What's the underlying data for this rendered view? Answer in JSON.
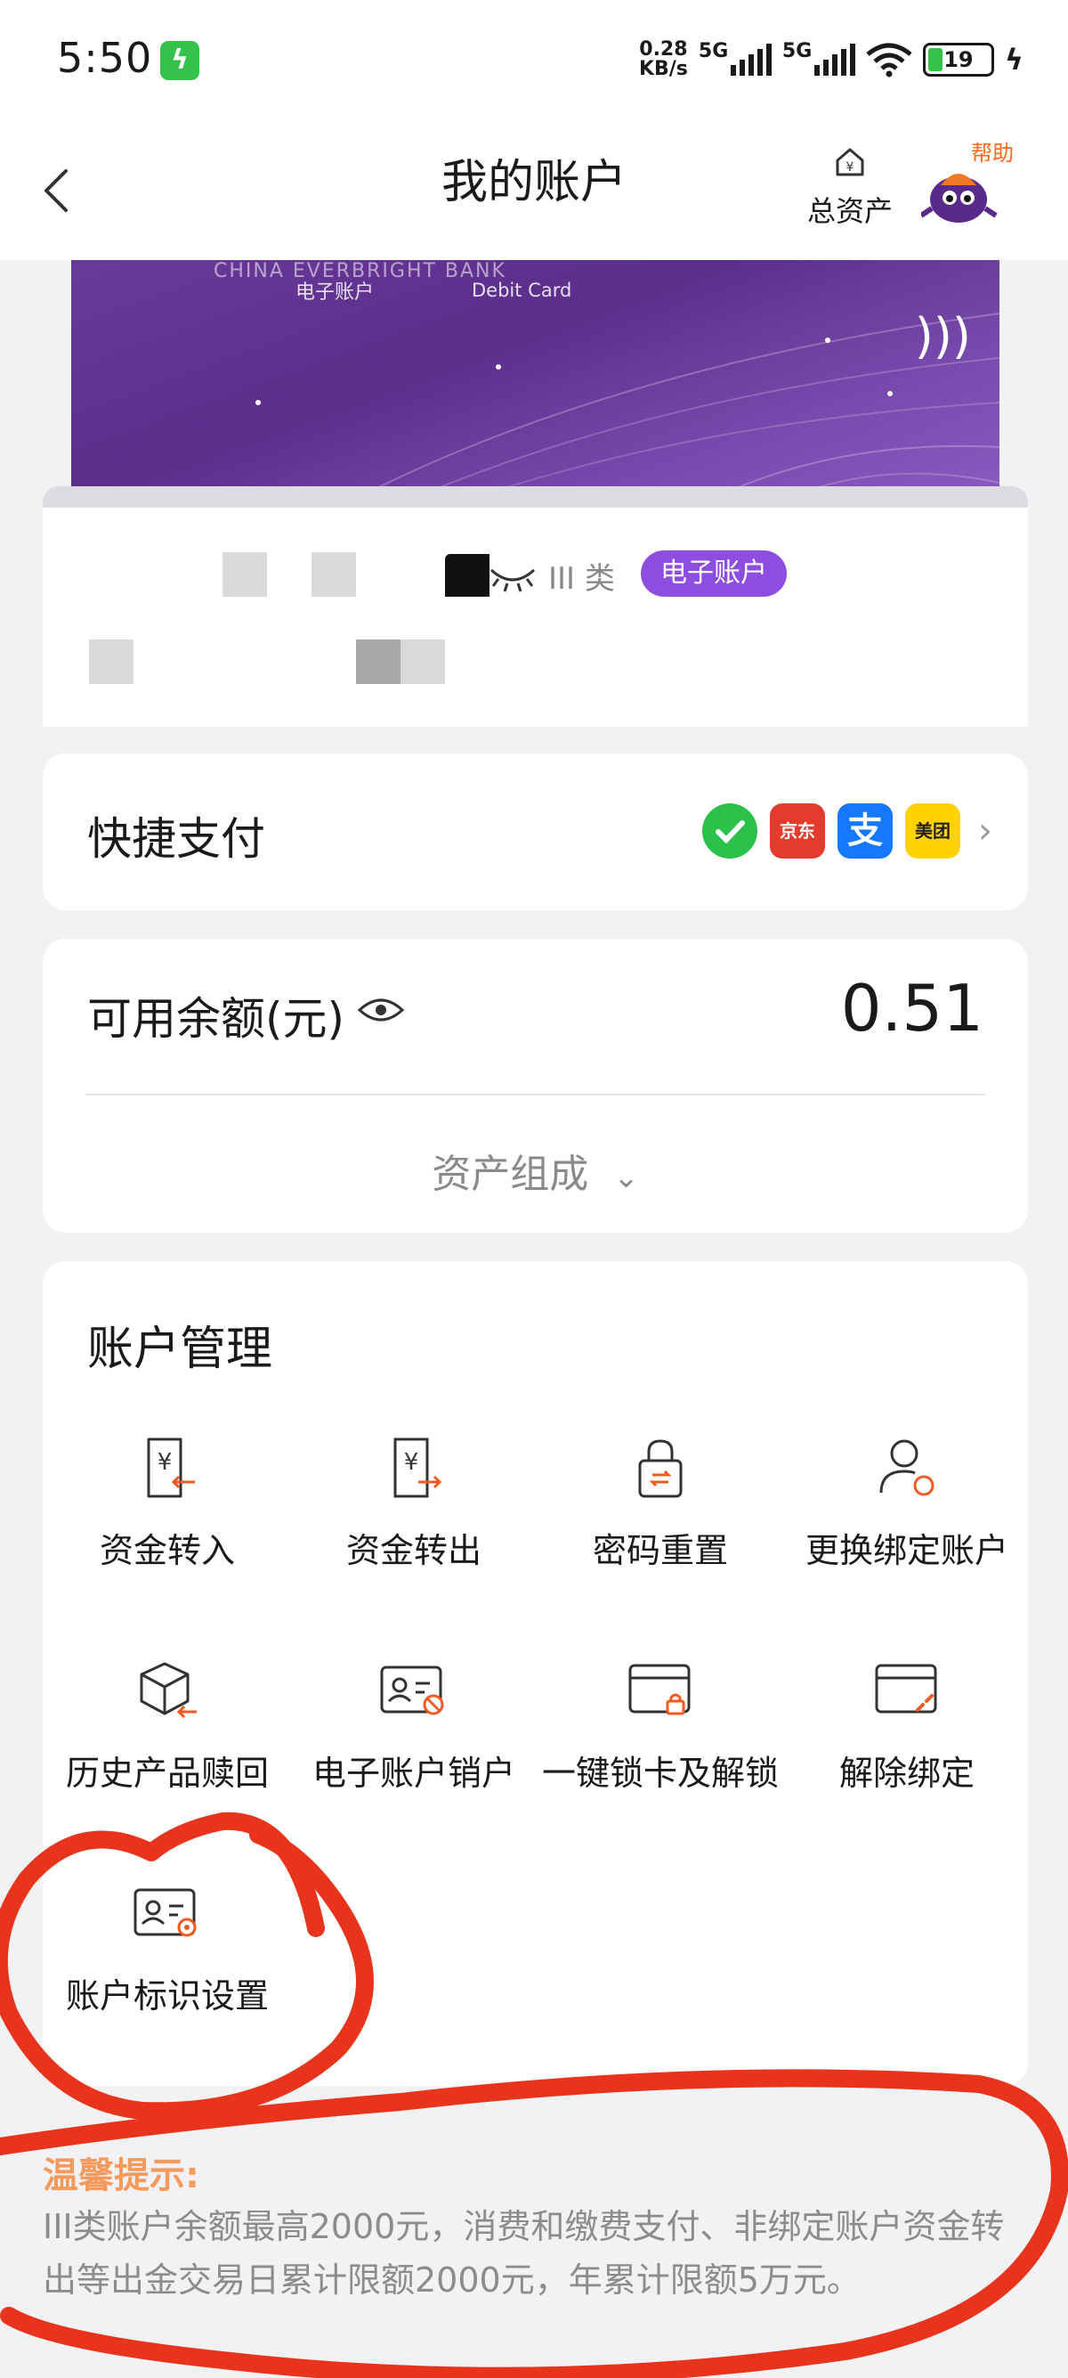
{
  "status_bar": {
    "time": "5:50",
    "net_speed_value": "0.28",
    "net_speed_unit": "KB/s",
    "sim1_type": "5G",
    "sim2_type": "5G",
    "battery": "19"
  },
  "header": {
    "title": "我的账户",
    "total_assets_label": "总资产",
    "help_label": "帮助"
  },
  "card": {
    "brand_text": "CHINA EVERBRIGHT BANK",
    "type_label": "电子账户",
    "debit_label": "Debit Card",
    "account_class": "III 类",
    "badge": "电子账户"
  },
  "quick_pay": {
    "title": "快捷支付",
    "partners": [
      "微信",
      "京东",
      "支付宝",
      "美团"
    ]
  },
  "balance": {
    "label": "可用余额(元)",
    "value": "0.51",
    "composition_label": "资产组成"
  },
  "account_management": {
    "title": "账户管理",
    "items": [
      {
        "label": "资金转入",
        "icon": "fund-in-icon"
      },
      {
        "label": "资金转出",
        "icon": "fund-out-icon"
      },
      {
        "label": "密码重置",
        "icon": "password-reset-icon"
      },
      {
        "label": "更换绑定账户",
        "icon": "change-bound-account-icon"
      },
      {
        "label": "历史产品赎回",
        "icon": "product-redeem-icon"
      },
      {
        "label": "电子账户销户",
        "icon": "close-account-icon"
      },
      {
        "label": "一键锁卡及解锁",
        "icon": "lock-card-icon"
      },
      {
        "label": "解除绑定",
        "icon": "unbind-icon"
      },
      {
        "label": "账户标识设置",
        "icon": "account-tag-icon"
      }
    ]
  },
  "notice": {
    "title": "温馨提示:",
    "text": "III类账户余额最高2000元，消费和缴费支付、非绑定账户资金转出等出金交易日累计限额2000元，年累计限额5万元。"
  },
  "colors": {
    "accent_orange": "#f05a22",
    "badge_purple": "#8d4de0",
    "annotation_red": "#e8341c"
  }
}
